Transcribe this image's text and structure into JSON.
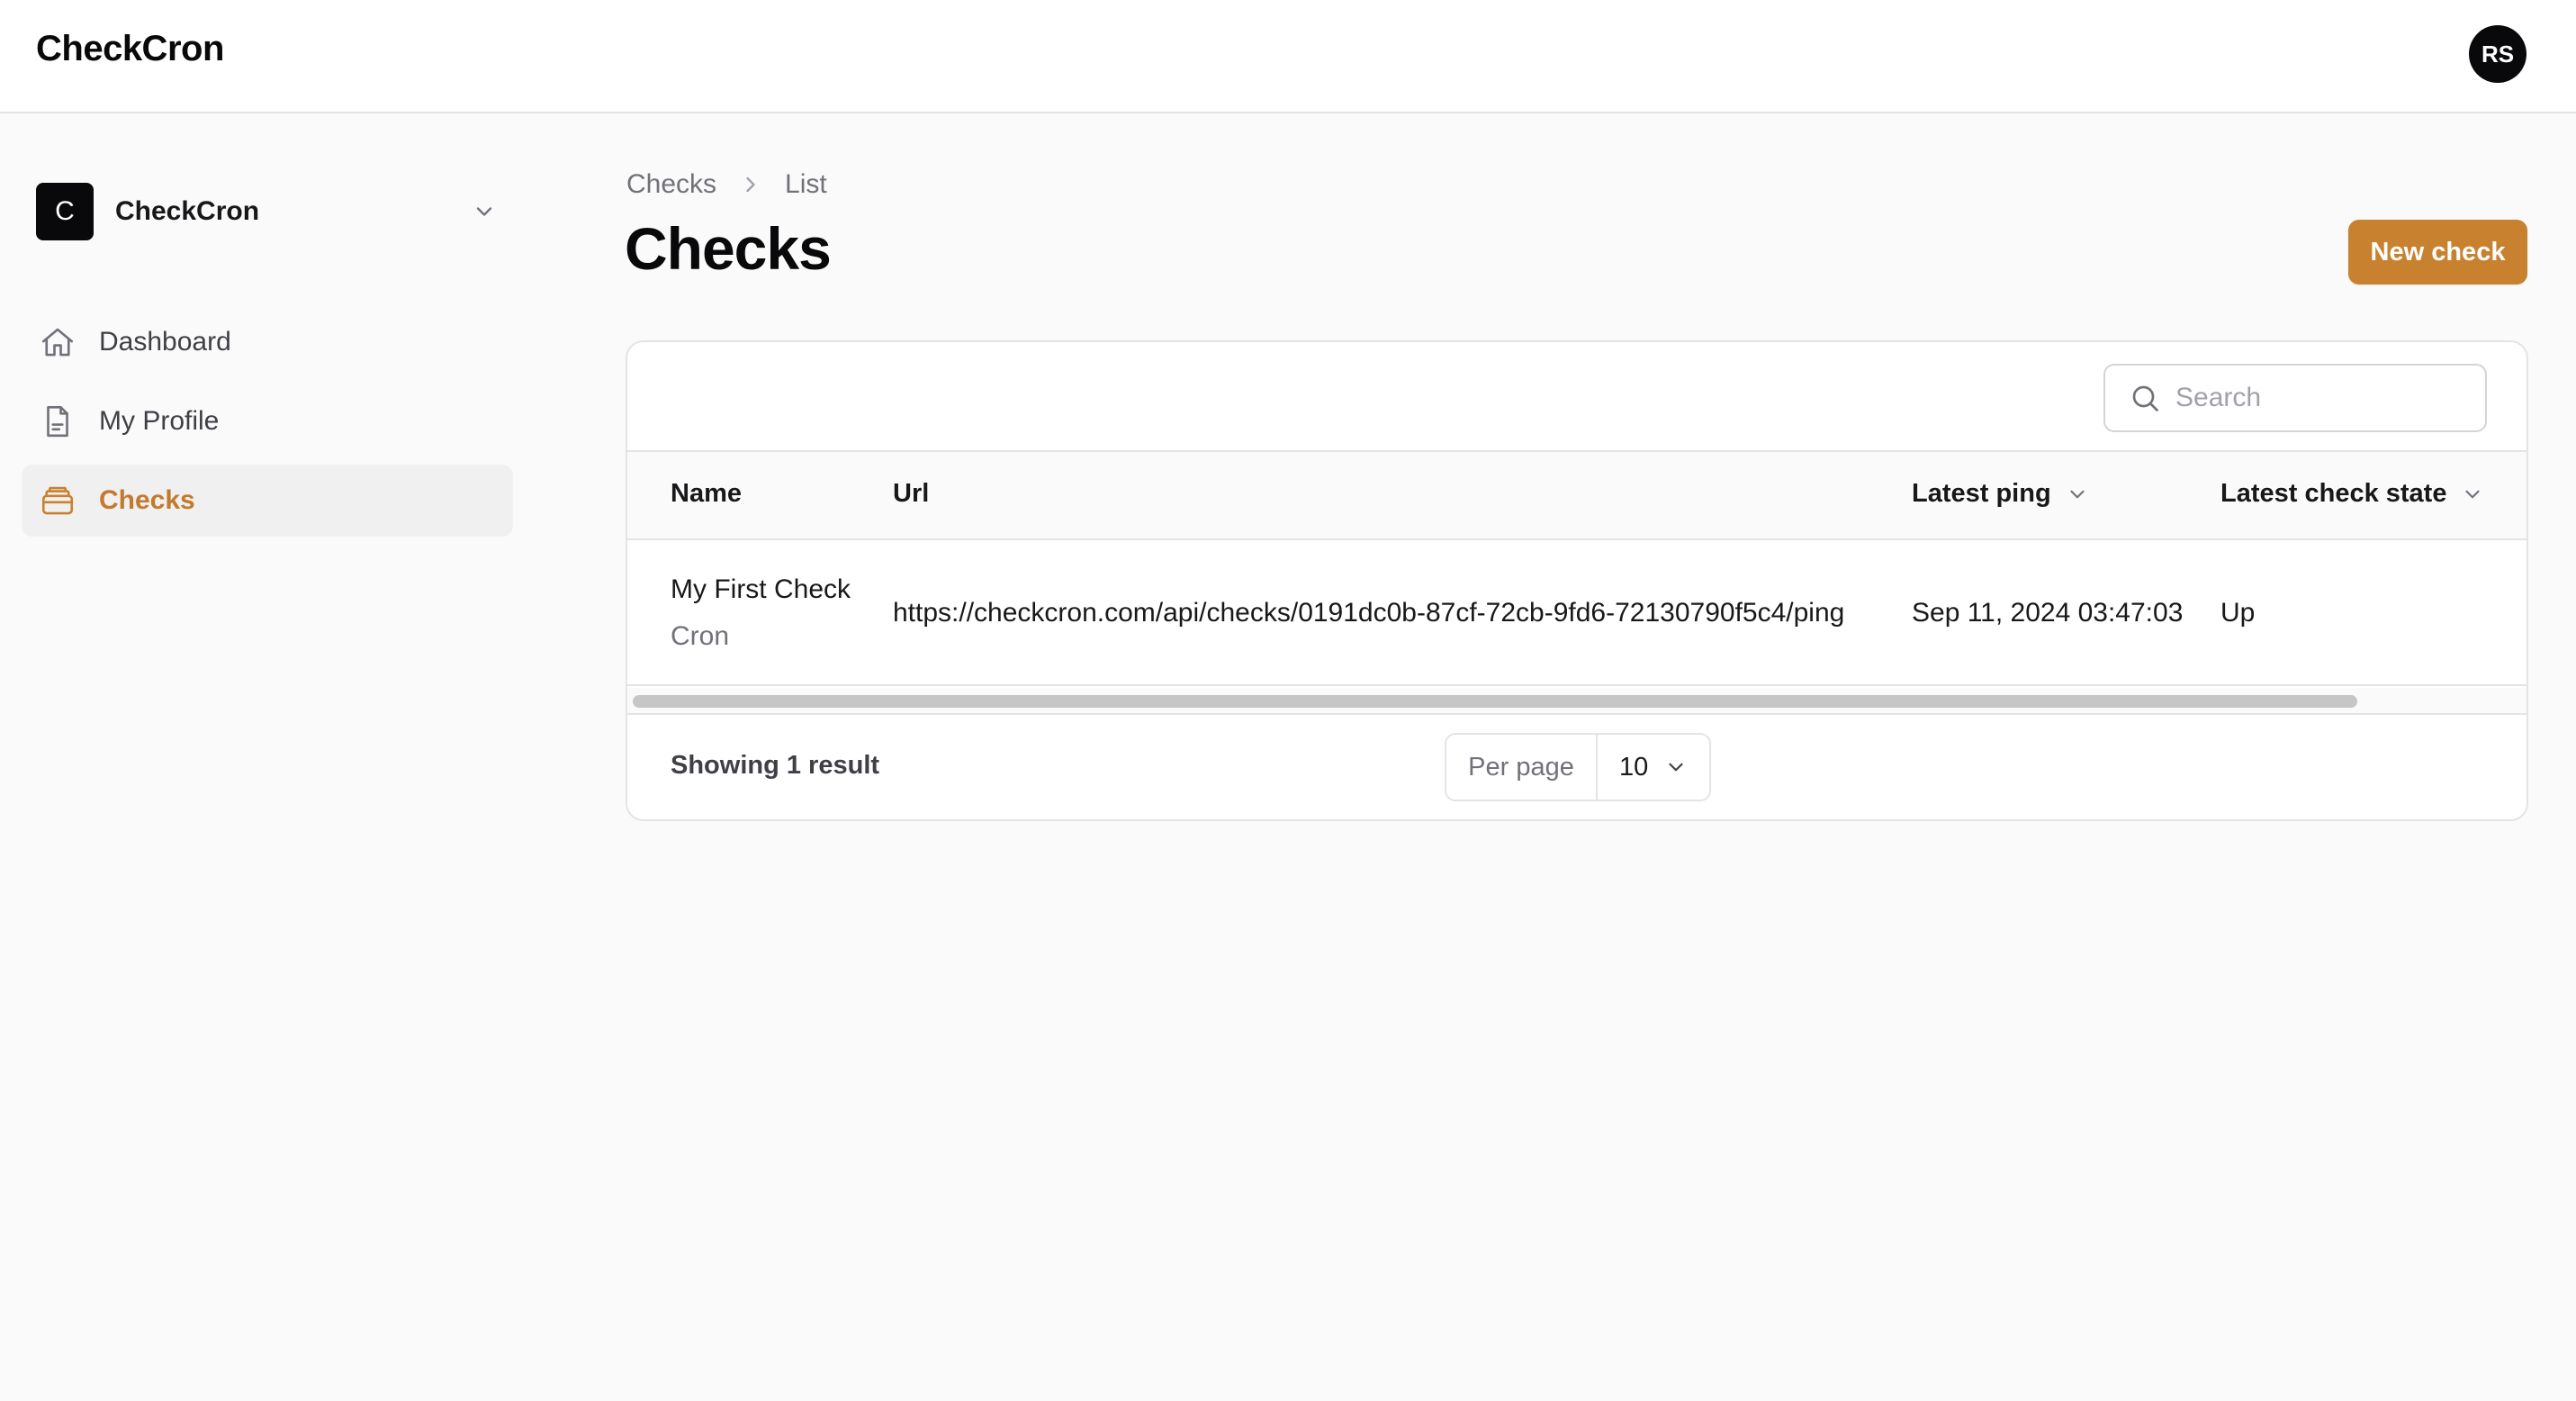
{
  "app": {
    "brand": "CheckCron",
    "user_initials": "RS"
  },
  "tenant": {
    "initial": "C",
    "name": "CheckCron"
  },
  "sidebar": {
    "items": [
      {
        "label": "Dashboard",
        "icon": "home-icon",
        "active": false
      },
      {
        "label": "My Profile",
        "icon": "document-icon",
        "active": false
      },
      {
        "label": "Checks",
        "icon": "checks-icon",
        "active": true
      }
    ]
  },
  "breadcrumb": [
    "Checks",
    "List"
  ],
  "page": {
    "title": "Checks",
    "new_button": "New check"
  },
  "search": {
    "placeholder": "Search",
    "value": ""
  },
  "table": {
    "columns": [
      "Name",
      "Url",
      "Latest ping",
      "Latest check state"
    ],
    "rows": [
      {
        "name": "My First Check",
        "type": "Cron",
        "url": "https://checkcron.com/api/checks/0191dc0b-87cf-72cb-9fd6-72130790f5c4/ping",
        "latest_ping": "Sep 11, 2024 03:47:03",
        "state": "Up"
      }
    ]
  },
  "footer": {
    "summary": "Showing 1 result",
    "per_page_label": "Per page",
    "per_page_value": "10"
  },
  "colors": {
    "accent": "#c8822f",
    "active_nav_bg": "#f0f0f1",
    "brand_dark": "#09090b"
  }
}
